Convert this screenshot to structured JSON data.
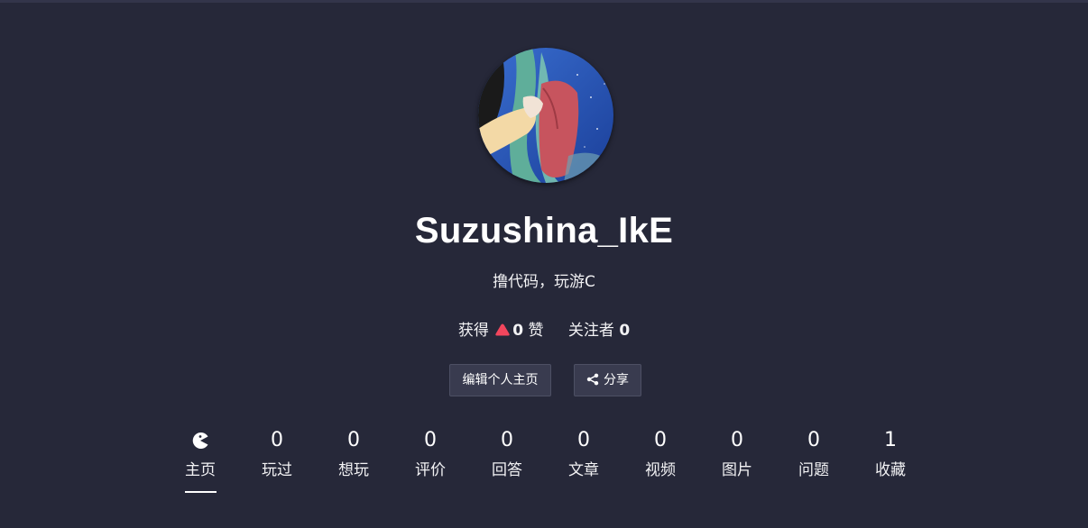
{
  "profile": {
    "username": "Suzushina_IkE",
    "bio": "撸代码，玩游C",
    "avatar_icon": "anime-avatar-image"
  },
  "stats": {
    "likes_prefix": "获得",
    "likes_count": "0",
    "likes_suffix": "赞",
    "followers_label": "关注者",
    "followers_count": "0",
    "like_color": "#f2465d"
  },
  "buttons": {
    "edit_label": "编辑个人主页",
    "share_label": "分享",
    "share_icon": "share-icon"
  },
  "tabs": [
    {
      "count_icon": "pacman-icon",
      "label": "主页",
      "active": true
    },
    {
      "count": "0",
      "label": "玩过"
    },
    {
      "count": "0",
      "label": "想玩"
    },
    {
      "count": "0",
      "label": "评价"
    },
    {
      "count": "0",
      "label": "回答"
    },
    {
      "count": "0",
      "label": "文章"
    },
    {
      "count": "0",
      "label": "视频"
    },
    {
      "count": "0",
      "label": "图片"
    },
    {
      "count": "0",
      "label": "问题"
    },
    {
      "count": "1",
      "label": "收藏"
    }
  ],
  "colors": {
    "background": "#262839",
    "button_bg": "#393b4f",
    "accent_like": "#f2465d"
  }
}
